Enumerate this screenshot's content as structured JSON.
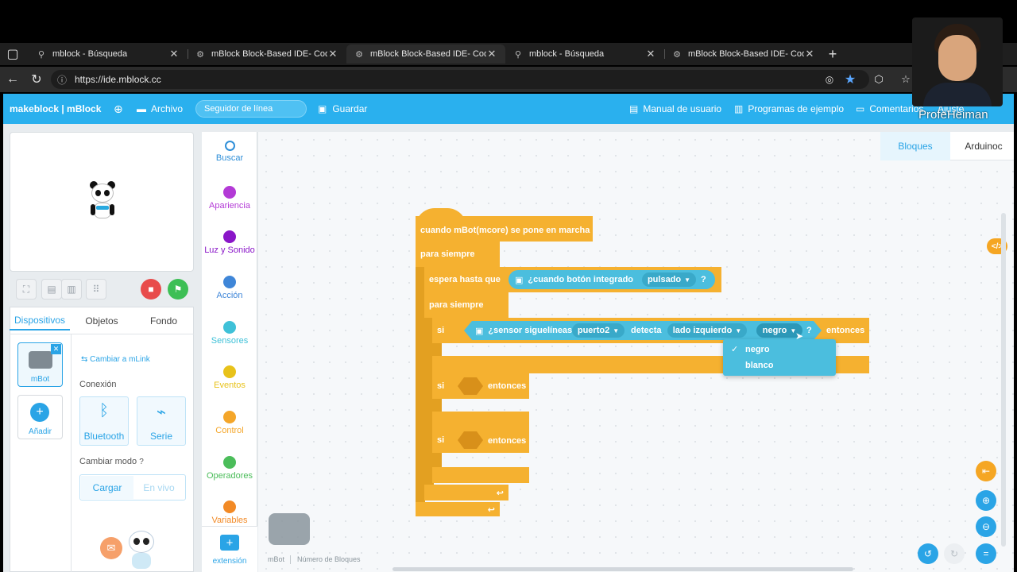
{
  "browser": {
    "tabs": [
      {
        "label": "mblock - Búsqueda",
        "icon": "search-icon"
      },
      {
        "label": "mBlock Block-Based IDE- Coding",
        "icon": "gear-icon"
      },
      {
        "label": "mBlock Block-Based IDE- Coding",
        "icon": "gear-icon"
      },
      {
        "label": "mblock - Búsqueda",
        "icon": "search-icon"
      },
      {
        "label": "mBlock Block-Based IDE- Coding",
        "icon": "gear-icon"
      }
    ],
    "new_tab": "+",
    "close_glyph": "✕",
    "url": "https://ide.mblock.cc"
  },
  "header": {
    "logo": "makeblock | mBlock",
    "file": "Archivo",
    "project_name": "Seguidor de línea",
    "save": "Guardar",
    "manual": "Manual de usuario",
    "examples": "Programas de ejemplo",
    "comments": "Comentarios",
    "settings": "Ajuste",
    "user": "ProfeHeiman"
  },
  "panel_tabs": {
    "devices": "Dispositivos",
    "sprites": "Objetos",
    "background": "Fondo"
  },
  "device": {
    "name": "mBot",
    "add": "Añadir",
    "switch_link": "Cambiar a mLink",
    "connection_label": "Conexión",
    "bluetooth": "Bluetooth",
    "serial": "Serie",
    "mode_label": "Cambiar modo",
    "upload": "Cargar",
    "live": "En vivo"
  },
  "categories": [
    {
      "label": "Buscar",
      "color": "#2f8fd8"
    },
    {
      "label": "Apariencia",
      "color": "#b33ad6"
    },
    {
      "label": "Luz y Sonido",
      "color": "#8a16c8"
    },
    {
      "label": "Acción",
      "color": "#3f86d8"
    },
    {
      "label": "Sensores",
      "color": "#3fc1d8"
    },
    {
      "label": "Eventos",
      "color": "#e8c21a"
    },
    {
      "label": "Control",
      "color": "#f4a62a"
    },
    {
      "label": "Operadores",
      "color": "#4bbd5a"
    },
    {
      "label": "Variables",
      "color": "#f28a26"
    }
  ],
  "extension": "extensión",
  "editor_tabs": {
    "blocks": "Bloques",
    "arduino": "Arduinoc"
  },
  "code_toggle": "</>",
  "blocks": {
    "hat": "cuando mBot(mcore) se pone en marcha",
    "forever1": "para siempre",
    "wait_until": "espera hasta que",
    "button_q": "¿cuando botón integrado",
    "pressed": "pulsado",
    "q": "?",
    "forever2": "para siempre",
    "if": "si",
    "sensor_q": "¿sensor siguelíneas",
    "port": "puerto2",
    "detects": "detecta",
    "side": "lado izquierdo",
    "color": "negro",
    "then": "entonces",
    "if2": "si",
    "then2": "entonces",
    "if3": "si",
    "then3": "entonces"
  },
  "dropdown": {
    "check": "✓",
    "options": [
      "negro",
      "blanco"
    ]
  },
  "footer": {
    "sprite": "mBot",
    "block_count": "Número de Bloques"
  }
}
